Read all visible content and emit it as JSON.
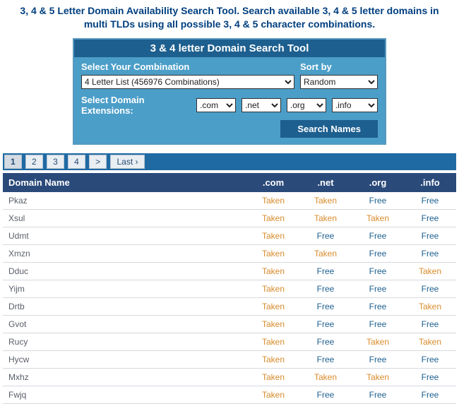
{
  "heading": "3, 4 & 5 Letter Domain Availability Search Tool. Search available 3, 4 & 5 letter domains in multi TLDs using all possible 3, 4 & 5 character combinations.",
  "tool": {
    "title": "3 & 4 letter Domain Search Tool",
    "combo_label": "Select Your Combination",
    "combo_value": "4 Letter List (456976 Combinations)",
    "sort_label": "Sort by",
    "sort_value": "Random",
    "ext_label": "Select Domain Extensions:",
    "ext1": ".com",
    "ext2": ".net",
    "ext3": ".org",
    "ext4": ".info",
    "search_btn": "Search Names"
  },
  "pager": {
    "p1": "1",
    "p2": "2",
    "p3": "3",
    "p4": "4",
    "next": ">",
    "last": "Last ›"
  },
  "table": {
    "col_name": "Domain Name",
    "col_com": ".com",
    "col_net": ".net",
    "col_org": ".org",
    "col_info": ".info",
    "status": {
      "taken": "Taken",
      "free": "Free"
    },
    "rows": [
      {
        "name": "Pkaz",
        "com": "taken",
        "net": "taken",
        "org": "free",
        "info": "free"
      },
      {
        "name": "Xsul",
        "com": "taken",
        "net": "taken",
        "org": "taken",
        "info": "free"
      },
      {
        "name": "Udmt",
        "com": "taken",
        "net": "free",
        "org": "free",
        "info": "free"
      },
      {
        "name": "Xmzn",
        "com": "taken",
        "net": "taken",
        "org": "free",
        "info": "free"
      },
      {
        "name": "Dduc",
        "com": "taken",
        "net": "free",
        "org": "free",
        "info": "taken"
      },
      {
        "name": "Yijm",
        "com": "taken",
        "net": "free",
        "org": "free",
        "info": "free"
      },
      {
        "name": "Drtb",
        "com": "taken",
        "net": "free",
        "org": "free",
        "info": "taken"
      },
      {
        "name": "Gvot",
        "com": "taken",
        "net": "free",
        "org": "free",
        "info": "free"
      },
      {
        "name": "Rucy",
        "com": "taken",
        "net": "free",
        "org": "taken",
        "info": "taken"
      },
      {
        "name": "Hycw",
        "com": "taken",
        "net": "free",
        "org": "free",
        "info": "free"
      },
      {
        "name": "Mxhz",
        "com": "taken",
        "net": "taken",
        "org": "taken",
        "info": "free"
      },
      {
        "name": "Fwjq",
        "com": "taken",
        "net": "free",
        "org": "free",
        "info": "free"
      }
    ]
  }
}
